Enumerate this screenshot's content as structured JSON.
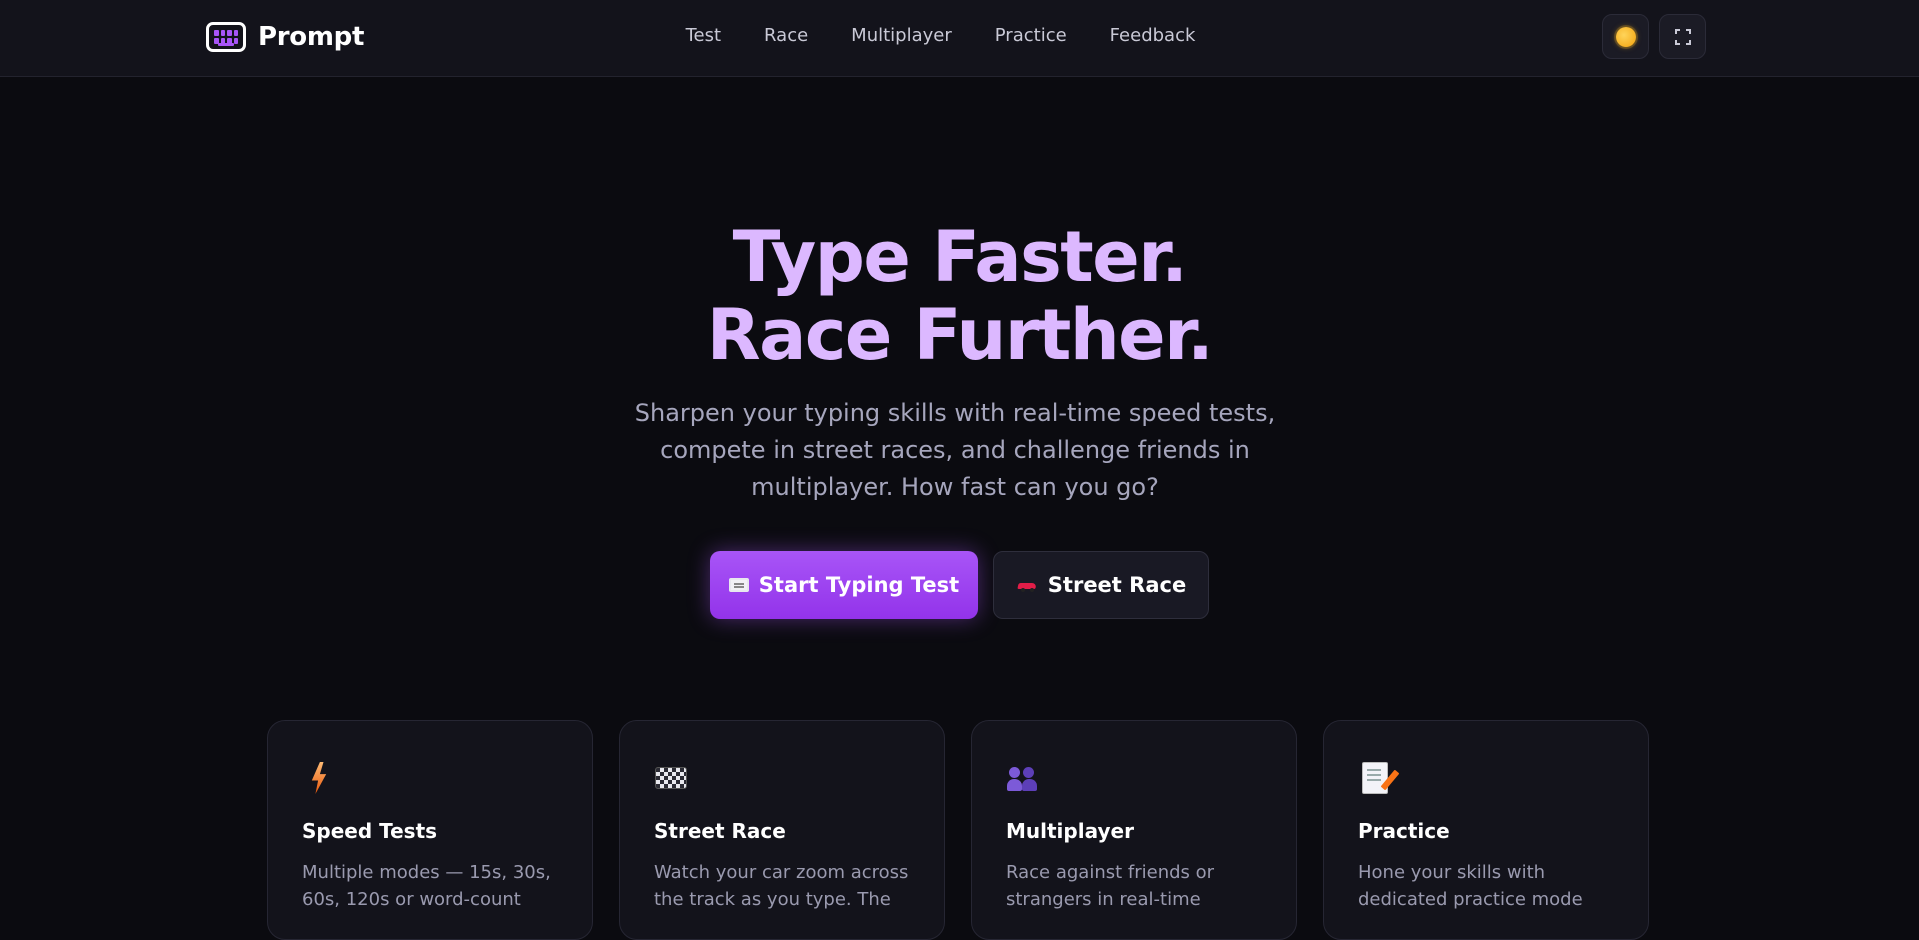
{
  "brand": {
    "name": "Prompt",
    "icon": "keyboard-icon"
  },
  "nav": {
    "items": [
      {
        "label": "Test"
      },
      {
        "label": "Race"
      },
      {
        "label": "Multiplayer"
      },
      {
        "label": "Practice"
      },
      {
        "label": "Feedback"
      }
    ]
  },
  "header_actions": {
    "theme_icon": "sun-icon",
    "fullscreen_icon": "fullscreen-icon"
  },
  "hero": {
    "title_line1": "Type Faster.",
    "title_line2": "Race Further.",
    "subtitle": "Sharpen your typing skills with real-time speed tests, compete in street races, and challenge friends in multiplayer. How fast can you go?",
    "primary_cta": {
      "label": "Start Typing Test",
      "icon": "keyboard-icon"
    },
    "secondary_cta": {
      "label": "Street Race",
      "icon": "race-car-icon"
    }
  },
  "features": [
    {
      "title": "Speed Tests",
      "description": "Multiple modes — 15s, 30s, 60s, 120s or word-count",
      "icon": "lightning-icon"
    },
    {
      "title": "Street Race",
      "description": "Watch your car zoom across the track as you type. The",
      "icon": "checkered-flag-icon"
    },
    {
      "title": "Multiplayer",
      "description": "Race against friends or strangers in real-time",
      "icon": "people-icon"
    },
    {
      "title": "Practice",
      "description": "Hone your skills with dedicated practice mode",
      "icon": "memo-icon"
    }
  ],
  "colors": {
    "background": "#0b0b10",
    "accent": "#a855f7",
    "title": "#dcb8ff"
  }
}
